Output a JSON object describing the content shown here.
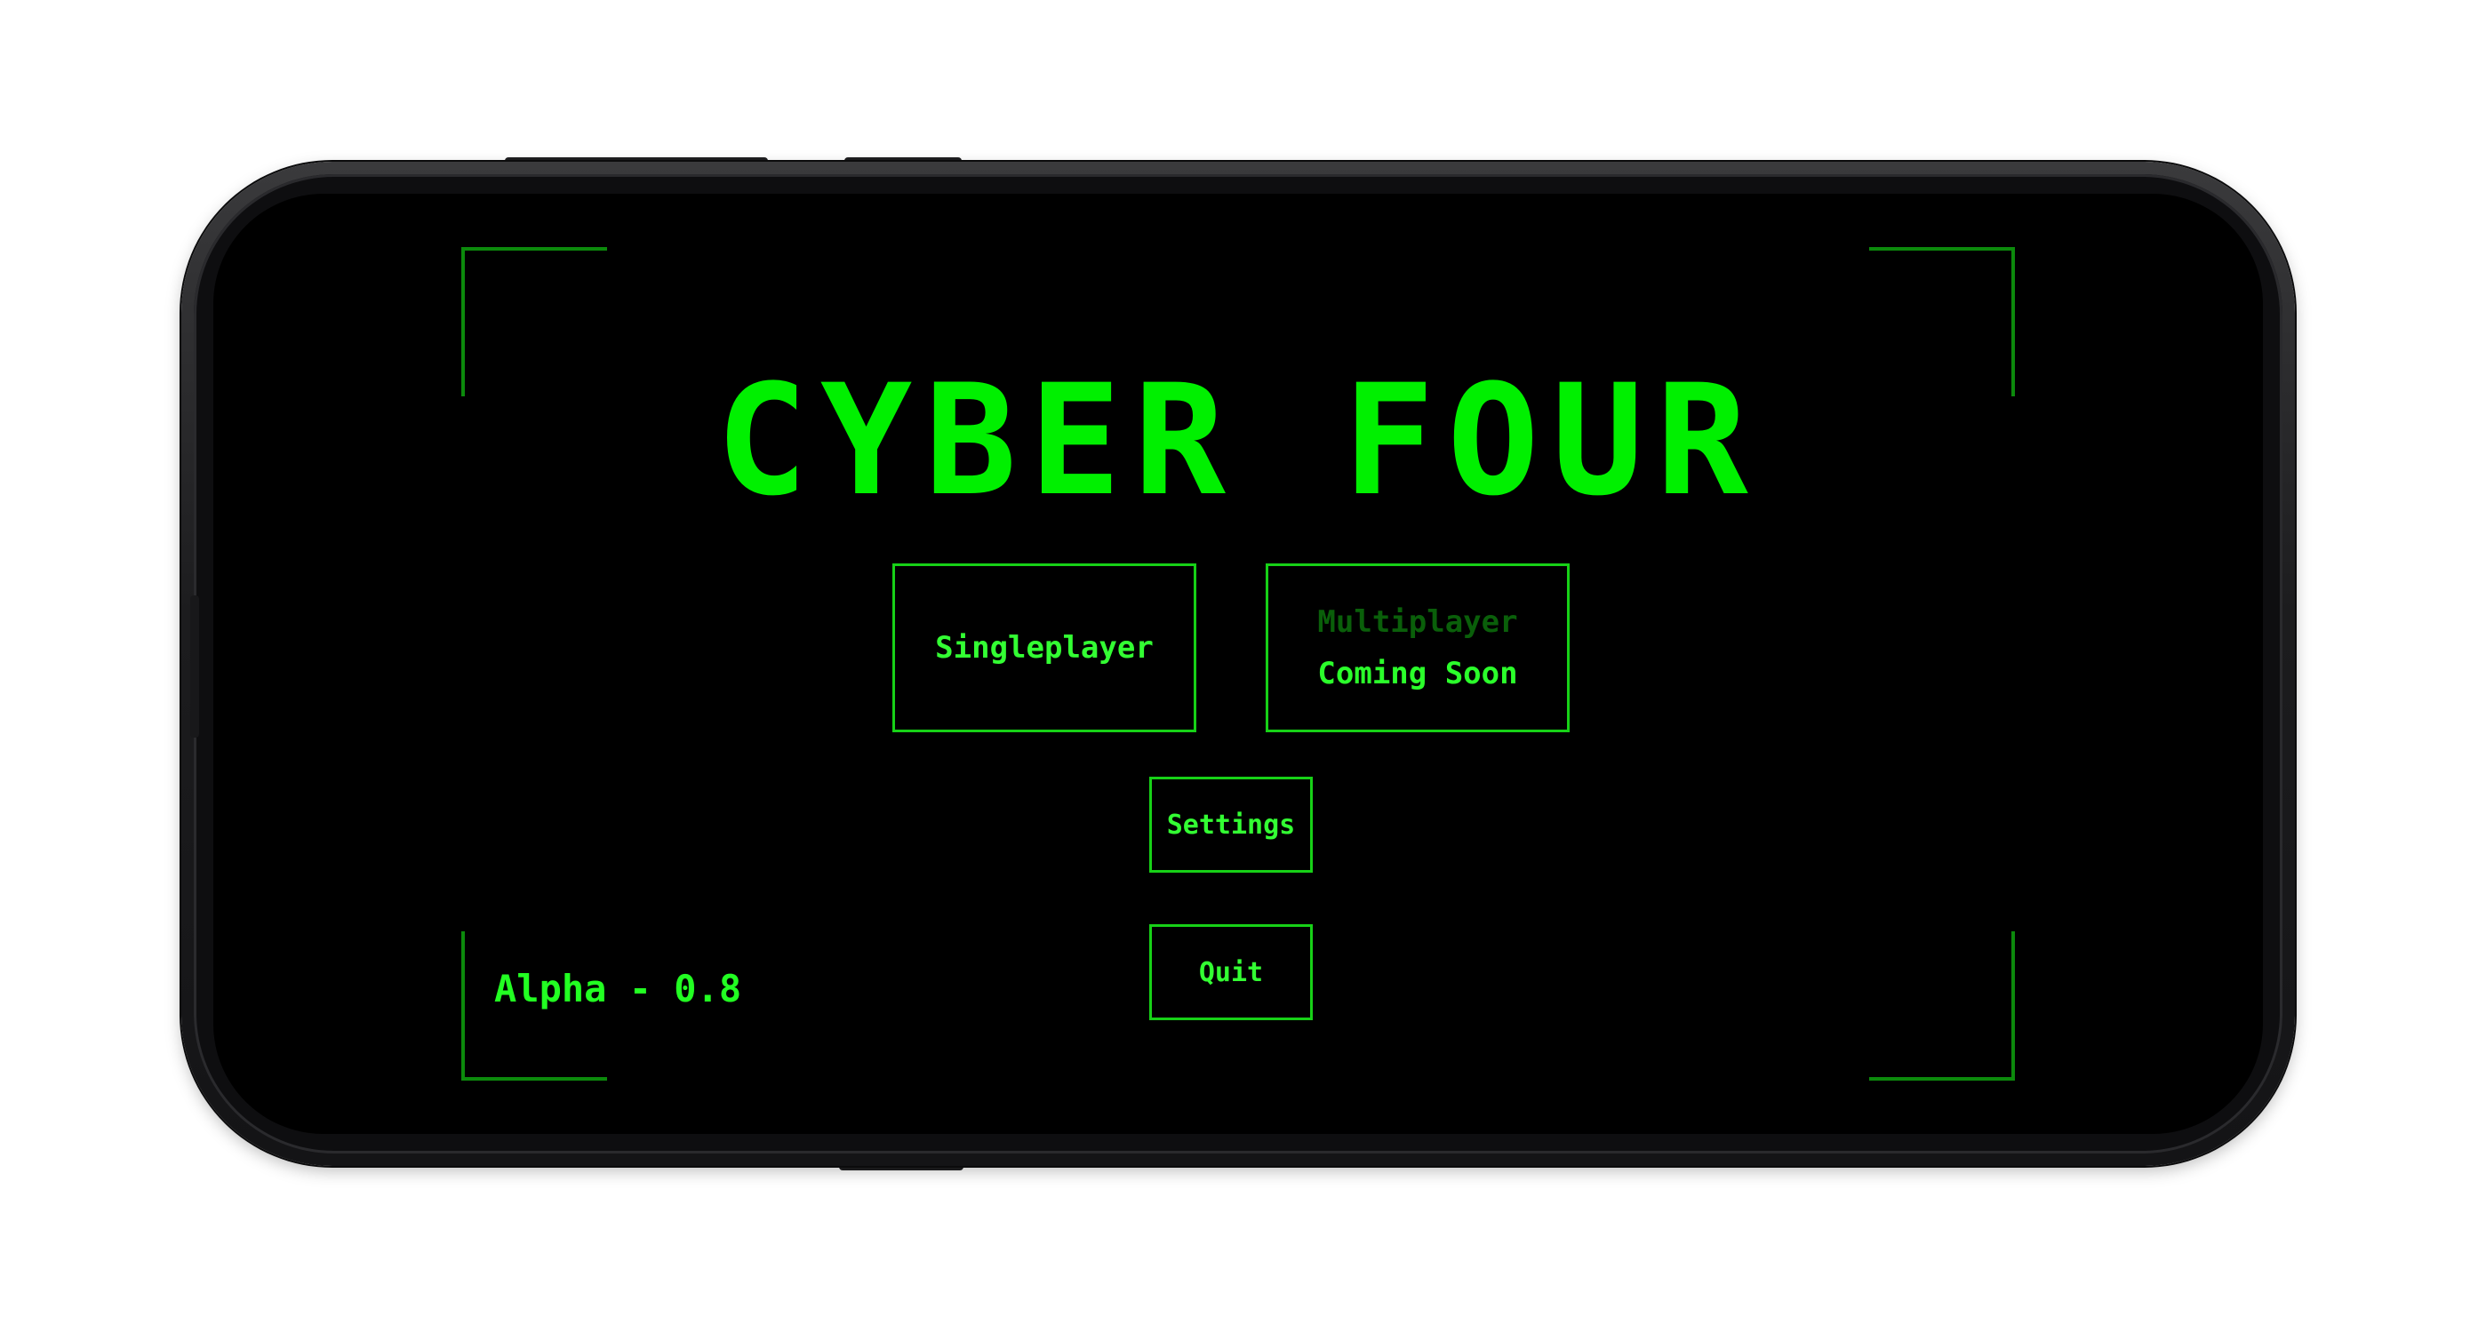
{
  "game": {
    "title": "CYBER FOUR",
    "version_label": "Alpha - 0.8"
  },
  "menu": {
    "singleplayer_label": "Singleplayer",
    "multiplayer_label": "Multiplayer",
    "multiplayer_status": "Coming Soon",
    "settings_label": "Settings",
    "quit_label": "Quit"
  },
  "colors": {
    "accent": "#00f000",
    "frame": "#0c8a0c",
    "disabled": "#0a5f0a",
    "background": "#000000"
  }
}
